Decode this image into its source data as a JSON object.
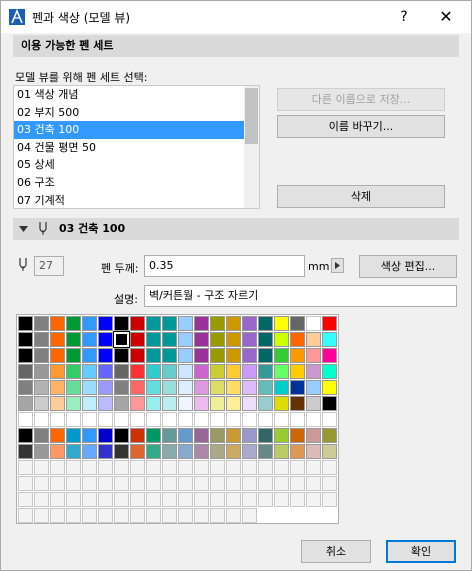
{
  "window": {
    "title": "펜과 색상 (모델 뷰)",
    "help": "?",
    "close": "✕",
    "accent": "#3399ff"
  },
  "available": {
    "header": "이용 가능한 펜 세트",
    "prompt": "모델 뷰를 위해 펜 세트 선택:",
    "items": [
      "01 색상 개념",
      "02 부지 500",
      "03 건축 100",
      "04 건물 평면 50",
      "05 상세",
      "06 구조",
      "07 기계적"
    ],
    "selected_index": 2,
    "save_as": "다른 이름으로 저장...",
    "rename": "이름 바꾸기...",
    "delete": "삭제"
  },
  "penset": {
    "header": "03 건축 100",
    "pen_number": "27",
    "thickness_label": "펜 두께:",
    "thickness_value": "0.35",
    "unit": "mm",
    "edit_color": "색상 편집...",
    "desc_label": "설명:",
    "desc_value": "벽/커튼월 - 구조 자르기"
  },
  "palette": {
    "columns": 20,
    "selected_pen": 27,
    "colors": [
      "#000000",
      "#808080",
      "#ff6600",
      "#009933",
      "#3399ff",
      "#0000ff",
      "#000000",
      "#cc0000",
      "#009999",
      "#009999",
      "#99ccff",
      "#993399",
      "#999900",
      "#cc9900",
      "#9966cc",
      "#006666",
      "#ffff00",
      "#666666",
      "#ffffff",
      "#ff0000",
      "#000000",
      "#808080",
      "#ff6600",
      "#009933",
      "#3399ff",
      "#0000ff",
      "#000000",
      "#cc0000",
      "#009999",
      "#009999",
      "#99ccff",
      "#993399",
      "#999900",
      "#cc9900",
      "#9966cc",
      "#006666",
      "#ccff00",
      "#ff6600",
      "#ffcc99",
      "#33ffff",
      "#000000",
      "#808080",
      "#ff6600",
      "#009933",
      "#3399ff",
      "#0000ff",
      "#000000",
      "#cc0000",
      "#009999",
      "#009999",
      "#99ccff",
      "#993399",
      "#999900",
      "#cc9900",
      "#9966cc",
      "#006666",
      "#33cc33",
      "#ff9900",
      "#ff9999",
      "#ff0099",
      "#666666",
      "#999999",
      "#ff9933",
      "#33cc66",
      "#66ccff",
      "#6666ff",
      "#666666",
      "#ff3333",
      "#33cccc",
      "#66cccc",
      "#cce6ff",
      "#cc66cc",
      "#cccc33",
      "#ffcc33",
      "#cc99ff",
      "#339999",
      "#66ff66",
      "#ffcc00",
      "#cc99cc",
      "#00ffcc",
      "#808080",
      "#b3b3b3",
      "#ffb366",
      "#66dd99",
      "#99ddff",
      "#9999ff",
      "#808080",
      "#ff6666",
      "#66dddd",
      "#99dddd",
      "#ddeeff",
      "#dd99dd",
      "#dddd66",
      "#ffdd66",
      "#ddbbff",
      "#66bbbb",
      "#00cccc",
      "#003399",
      "#99ccff",
      "#ffff00",
      "#a6a6a6",
      "#cccccc",
      "#ffcc99",
      "#99eebb",
      "#bbeeff",
      "#bbbbff",
      "#a6a6a6",
      "#ff9999",
      "#99eeee",
      "#bbeeee",
      "#eef6ff",
      "#eebbee",
      "#eeee99",
      "#ffee99",
      "#eeddff",
      "#99cccc",
      "#dddd00",
      "#663300",
      "#cccccc",
      "#000000",
      "#ffffff",
      "#ffffff",
      "#ffffff",
      "#ffffff",
      "#ffffff",
      "#ffffff",
      "#ffffff",
      "#ffffff",
      "#ffffff",
      "#ffffff",
      "#ffffff",
      "#ffffff",
      "#ffffff",
      "#ffffff",
      "#ffffff",
      "#ffffff",
      "#ffffff",
      "#ffffff",
      "#ffffff",
      "#ffffff",
      "#000000",
      "#808080",
      "#ff6600",
      "#0099cc",
      "#3399ff",
      "#0000cc",
      "#000000",
      "#cc3300",
      "#009966",
      "#669999",
      "#6699cc",
      "#996699",
      "#999966",
      "#cc9933",
      "#9999cc",
      "#336666",
      "#99cc33",
      "#cc6600",
      "#cc9999",
      "#999933",
      "#333333",
      "#999999",
      "#ff9966",
      "#33aacc",
      "#66aaff",
      "#3333cc",
      "#333333",
      "#dd6633",
      "#33aa88",
      "#88aaaa",
      "#88aacc",
      "#aa88aa",
      "#aaaa88",
      "#ccaa66",
      "#aaaacc",
      "#668888",
      "#bbcc66",
      "#dd9955",
      "#ddbbbb",
      "#cccc99",
      "",
      "",
      "",
      "",
      "",
      "",
      "",
      "",
      "",
      "",
      "",
      "",
      "",
      "",
      "",
      "",
      "",
      "",
      "",
      "",
      "",
      "",
      "",
      "",
      "",
      "",
      "",
      "",
      "",
      "",
      "",
      "",
      "",
      "",
      "",
      "",
      "",
      "",
      "",
      "",
      "",
      "",
      "",
      "",
      "",
      "",
      "",
      "",
      "",
      "",
      "",
      "",
      "",
      "",
      "",
      "",
      "",
      "",
      "",
      "",
      "",
      "",
      "",
      "",
      "",
      "",
      "",
      "",
      "",
      "",
      "",
      "",
      "",
      "",
      "",
      "",
      "",
      "",
      "",
      ""
    ]
  },
  "footer": {
    "cancel": "취소",
    "ok": "확인"
  }
}
